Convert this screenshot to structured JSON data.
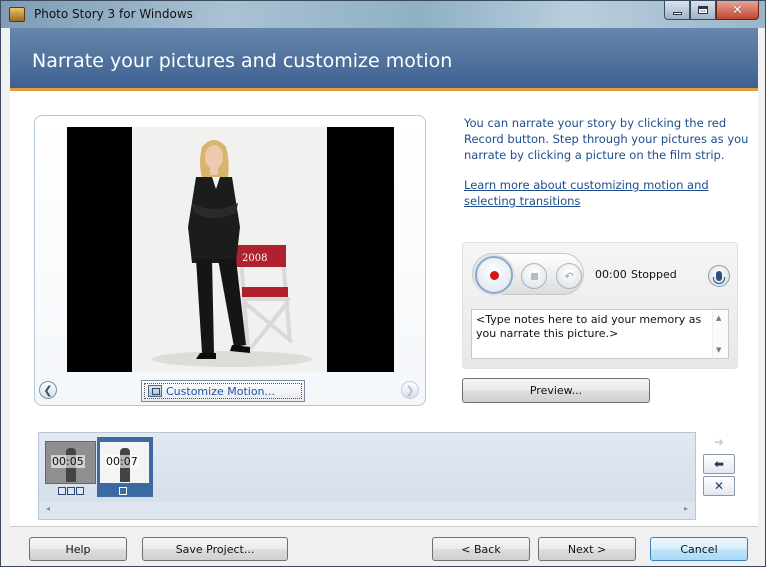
{
  "window": {
    "title": "Photo Story 3 for Windows",
    "close_glyph": "✕"
  },
  "header": {
    "title": "Narrate your pictures and customize motion"
  },
  "preview": {
    "photo_alt": "Current picture: woman standing beside a director's chair",
    "chair_text": "2008",
    "customize_motion_label": "Customize Motion...",
    "prev_glyph": "❮",
    "next_glyph": "❯"
  },
  "instructions": {
    "text": "You can narrate your story by clicking the red Record button. Step through your pictures as you narrate by clicking a picture on the film strip.",
    "link": "Learn more about customizing motion and selecting transitions"
  },
  "recorder": {
    "time": "00:00",
    "status": "Stopped",
    "undo_glyph": "↶",
    "notes": "<Type notes here to aid your memory as you narrate this picture.>"
  },
  "buttons": {
    "preview": "Preview...",
    "help": "Help",
    "save_project": "Save Project...",
    "back": "< Back",
    "next": "Next >",
    "cancel": "Cancel"
  },
  "filmstrip": {
    "items": [
      {
        "duration": "00:05",
        "selected": false
      },
      {
        "duration": "00:07",
        "selected": true
      }
    ],
    "move_right_glyph": "➜",
    "move_left_glyph": "⬅",
    "delete_glyph": "✕",
    "scroll_left_glyph": "◂",
    "scroll_right_glyph": "▸"
  },
  "icons": {
    "app": "photo-story-app-icon",
    "record": "record-icon",
    "stop": "stop-icon",
    "undo": "undo-icon",
    "microphone": "microphone-icon"
  },
  "colors": {
    "header_blue": "#4a6e9c",
    "accent_orange": "#e59a3a",
    "link_blue": "#1e4d8d",
    "record_red": "#d4141a",
    "selected_thumb": "#3b6aa3"
  }
}
